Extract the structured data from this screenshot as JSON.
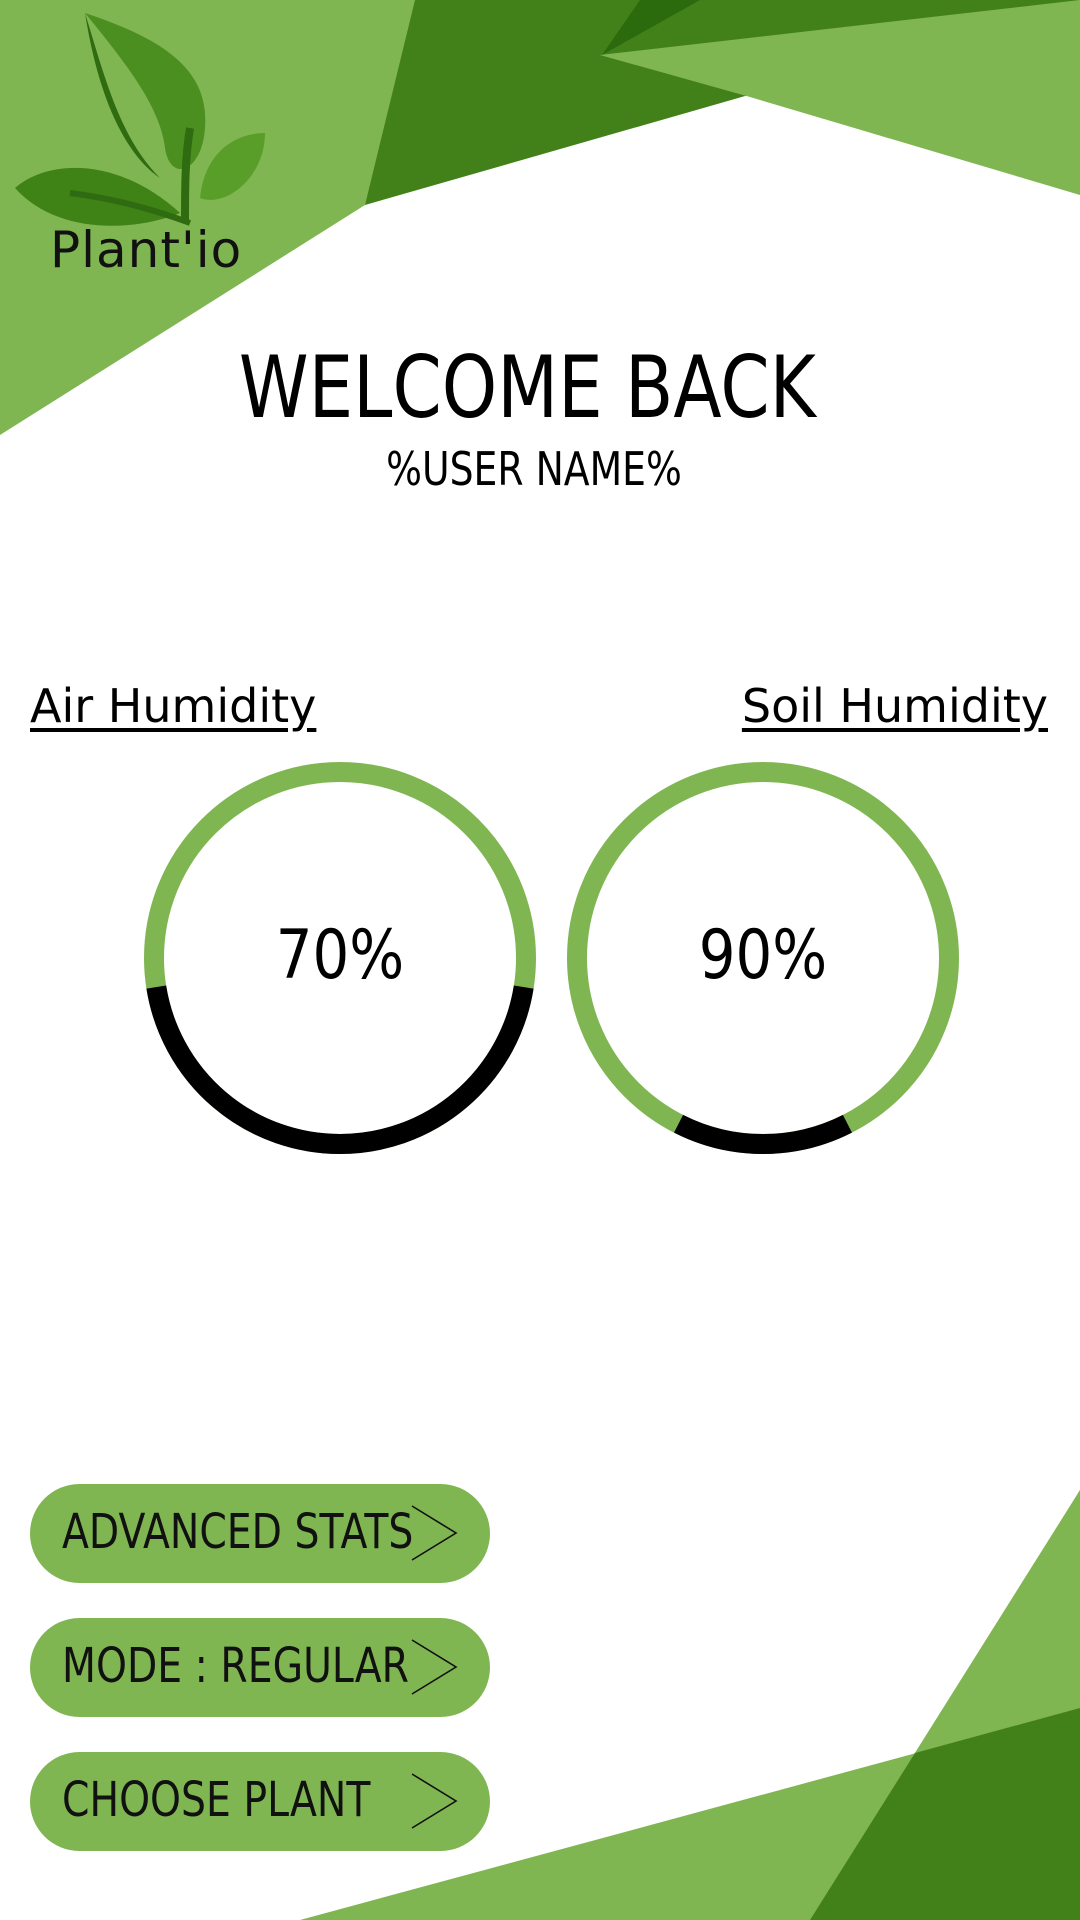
{
  "app": {
    "name": "Plant'io"
  },
  "colors": {
    "light_green": "#80b652",
    "dark_green": "#42811a",
    "deep_green": "#2b6a0d",
    "gauge_track": "#80b652",
    "gauge_fill": "#000000"
  },
  "header": {
    "title": "WELCOME BACK",
    "subtitle": "%USER NAME%"
  },
  "metrics": [
    {
      "label": "Air Humidity",
      "value_text": "70%",
      "value": 70
    },
    {
      "label": "Soil Humidity",
      "value_text": "90%",
      "value": 90
    }
  ],
  "actions": [
    {
      "label": "ADVANCED STATS",
      "icon": "chevron-right-icon"
    },
    {
      "label": "MODE : REGULAR",
      "icon": "chevron-right-icon"
    },
    {
      "label": "CHOOSE PLANT",
      "icon": "chevron-right-icon"
    }
  ]
}
